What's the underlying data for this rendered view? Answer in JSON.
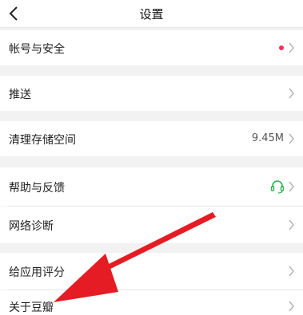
{
  "header": {
    "title": "设置",
    "back_icon": "chevron-left-icon"
  },
  "settings": {
    "account_security": {
      "label": "帐号与安全",
      "indicator_color": "#ff2e55"
    },
    "push": {
      "label": "推送"
    },
    "clear_storage": {
      "label": "清理存储空间",
      "value": "9.45M"
    },
    "help_feedback": {
      "label": "帮助与反馈",
      "icon": "headset-icon",
      "icon_color": "#2bb24c"
    },
    "network_diagnosis": {
      "label": "网络诊断"
    },
    "rate_app": {
      "label": "给应用评分"
    },
    "about": {
      "label": "关于豆瓣"
    }
  },
  "annotation": {
    "arrow_color": "#e51c23"
  }
}
